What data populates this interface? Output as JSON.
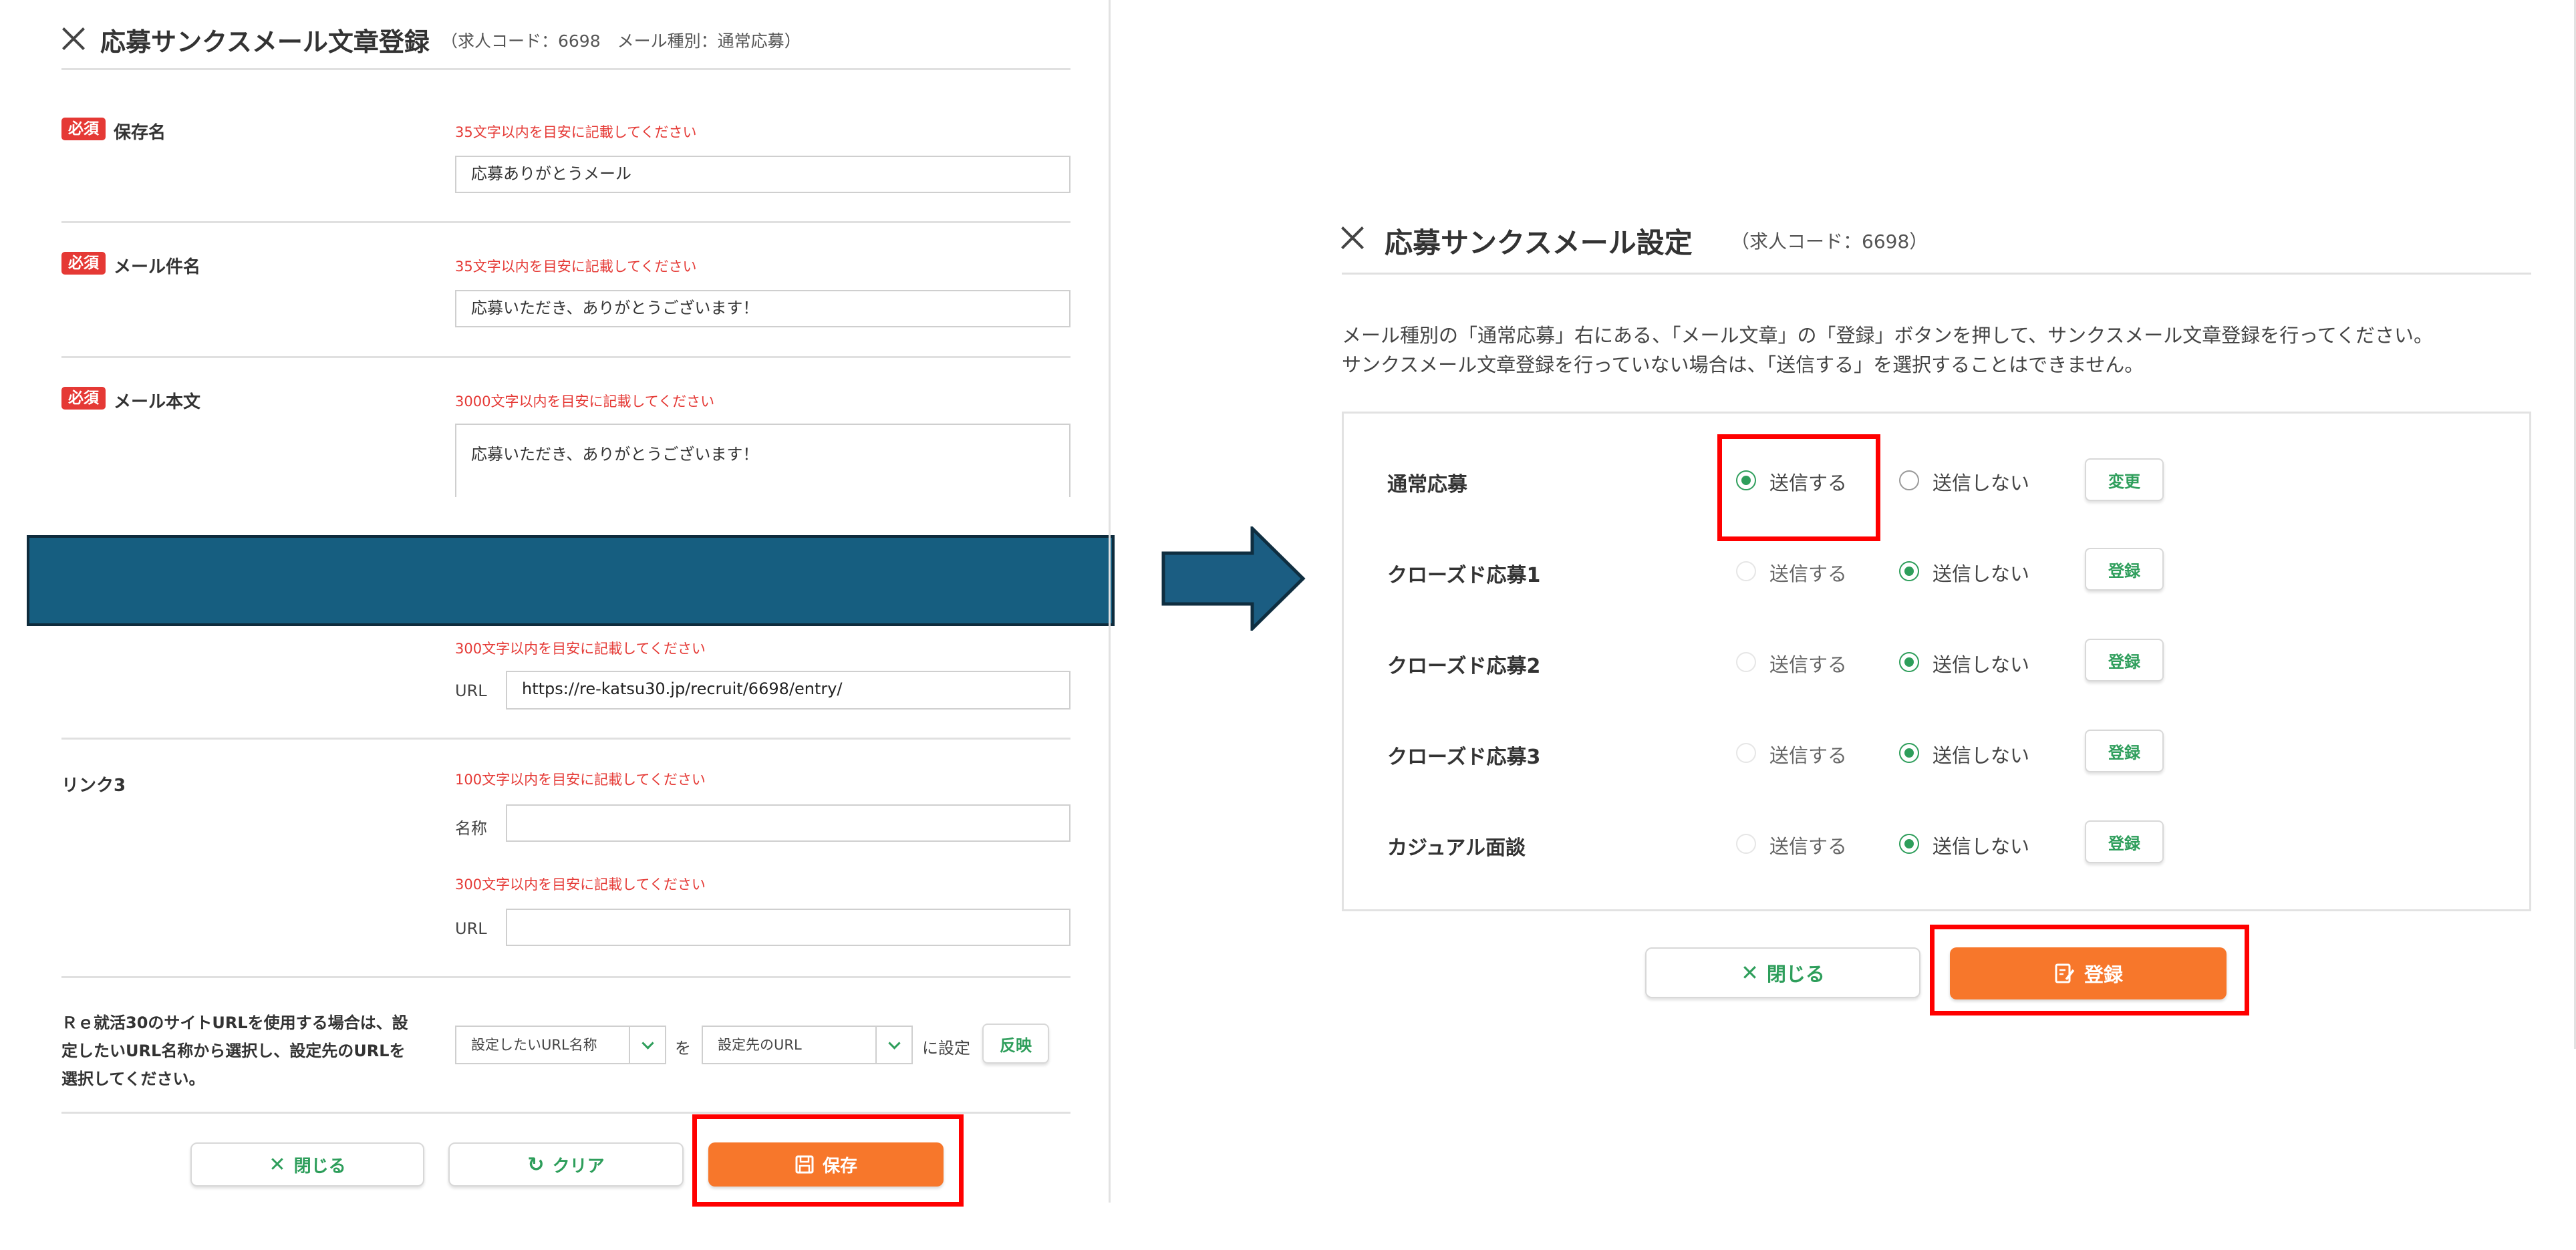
{
  "left": {
    "title": "応募サンクスメール文章登録",
    "subtitle": "（求人コード：6698　メール種別：通常応募）",
    "required_badge": "必須",
    "fields": {
      "save_name": {
        "label": "保存名",
        "hint": "35文字以内を目安に記載してください",
        "value": "応募ありがとうメール"
      },
      "subject": {
        "label": "メール件名",
        "hint": "35文字以内を目安に記載してください",
        "value": "応募いただき、ありがとうございます！"
      },
      "body": {
        "label": "メール本文",
        "hint": "3000文字以内を目安に記載してください",
        "value": "応募いただき、ありがとうございます！"
      }
    },
    "link2": {
      "url_hint": "300文字以内を目安に記載してください",
      "url_label": "URL",
      "url_value": "https://re-katsu30.jp/recruit/6698/entry/"
    },
    "link3": {
      "label": "リンク3",
      "name_hint": "100文字以内を目安に記載してください",
      "name_label": "名称",
      "name_value": "",
      "url_hint": "300文字以内を目安に記載してください",
      "url_label": "URL",
      "url_value": ""
    },
    "site_url": {
      "description_line1": "Ｒｅ就活30のサイトURLを使用する場合は、設",
      "description_line2": "定したいURL名称から選択し、設定先のURLを",
      "description_line3": "選択してください。",
      "select1": "設定したいURL名称",
      "connector": "を",
      "select2": "設定先のURL",
      "suffix": "に設定",
      "apply_button": "反映"
    },
    "buttons": {
      "close": "閉じる",
      "clear": "クリア",
      "save": "保存"
    }
  },
  "right": {
    "title": "応募サンクスメール設定",
    "subtitle": "（求人コード：6698）",
    "description_line1": "メール種別の「通常応募」右にある、「メール文章」の「登録」ボタンを押して、サンクスメール文章登録を行ってください。",
    "description_line2": "サンクスメール文章登録を行っていない場合は、「送信する」を選択することはできません。",
    "rows": [
      {
        "label": "通常応募",
        "send": "送信する",
        "nosend": "送信しない",
        "selected": "send",
        "button": "変更"
      },
      {
        "label": "クローズド応募1",
        "send": "送信する",
        "nosend": "送信しない",
        "selected": "nosend",
        "button": "登録"
      },
      {
        "label": "クローズド応募2",
        "send": "送信する",
        "nosend": "送信しない",
        "selected": "nosend",
        "button": "登録"
      },
      {
        "label": "クローズド応募3",
        "send": "送信する",
        "nosend": "送信しない",
        "selected": "nosend",
        "button": "登録"
      },
      {
        "label": "カジュアル面談",
        "send": "送信する",
        "nosend": "送信しない",
        "selected": "nosend",
        "button": "登録"
      }
    ],
    "buttons": {
      "close": "閉じる",
      "register": "登録"
    }
  },
  "colors": {
    "accent_green": "#2e9e5b",
    "orange": "#f7772b",
    "required_red": "#e53935",
    "highlight_red": "#ff0000",
    "banner_blue": "#165e80",
    "arrow_blue": "#1b5d82"
  }
}
